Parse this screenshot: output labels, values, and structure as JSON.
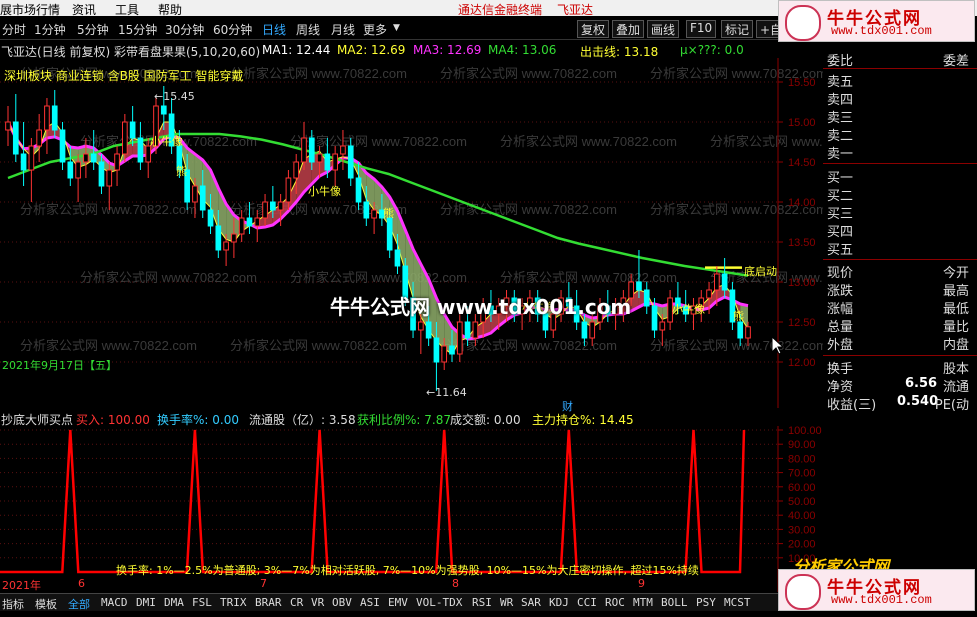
{
  "menubar": {
    "items": [
      "展市场行情",
      "资讯",
      "工具",
      "帮助"
    ],
    "center_promo": "通达信金融终端",
    "stock_name": "飞亚达"
  },
  "toolbar": {
    "periods": [
      "分时",
      "1分钟",
      "5分钟",
      "15分钟",
      "30分钟",
      "60分钟",
      "日线",
      "周线",
      "月线",
      "更多"
    ],
    "active_period": "日线",
    "more_arrow": "▼",
    "buttons": [
      "复权",
      "叠加",
      "画线",
      "F10",
      "标记",
      "+自选"
    ]
  },
  "infobar": {
    "title": "飞亚达(日线 前复权) 彩带看盘果果(5,10,20,60)",
    "ma1": "MA1: 12.44",
    "ma2": "MA2: 12.69",
    "ma3": "MA3: 12.69",
    "ma4": "MA4: 13.06",
    "chuji": "出击线: 13.18",
    "mu": "μ×???: 0.0"
  },
  "chart_info": {
    "sectors": "深圳板块 商业连锁 含B股 国防军工 智能穿戴",
    "high_mark": "15.45",
    "low_mark": "11.64",
    "date": "2021年9月17日【五】",
    "di_qi": "底启动",
    "labels": {
      "xn1": "小牛像",
      "xn2": "小牛像",
      "xn3": "小牛像",
      "xn4": "小牛像",
      "ting1": "熊",
      "ting2": "熊",
      "ting3": "熊"
    },
    "cai": "财",
    "yaxis": [
      "15.50",
      "15.00",
      "14.50",
      "14.00",
      "13.50",
      "13.00",
      "12.50",
      "12.00"
    ],
    "watermark": "分析家公式网 www.70822.com"
  },
  "overlay_watermark": "牛牛公式网 www.tdx001.com",
  "panel": {
    "header_left": "委比",
    "header_right": "委差",
    "sells": [
      "卖五",
      "卖四",
      "卖三",
      "卖二",
      "卖一"
    ],
    "buys": [
      "买一",
      "买二",
      "买三",
      "买四",
      "买五"
    ],
    "stats_left": [
      "现价",
      "涨跌",
      "涨幅",
      "总量",
      "外盘"
    ],
    "stats_right": [
      "今开",
      "最高",
      "最低",
      "量比",
      "内盘"
    ],
    "fin": [
      {
        "l": "换手",
        "r": "股本"
      },
      {
        "l": "净资",
        "v": "6.56",
        "r": "流通"
      },
      {
        "l": "收益(三)",
        "v": "0.540",
        "r": "PE(动"
      }
    ]
  },
  "indicator": {
    "name": "抄底大师买点",
    "buy": "买入: 100.00",
    "turnover": "换手率%: 0.00",
    "float": "流通股（亿）: 3.58",
    "profit": "获利比例%: 7.87",
    "amount": "成交额: 0.00",
    "main": "主力持仓%: 14.45",
    "yaxis": [
      "100.00",
      "90.00",
      "80.00",
      "70.00",
      "60.00",
      "50.00",
      "40.00",
      "30.00",
      "20.00",
      "10.00"
    ],
    "note": "换手率: 1%—2.5%为普通股; 3%—7%为相对活跃股, 7%—10%为强势股, 10%—15%为大庄密切操作, 超过15%持续"
  },
  "xaxis": {
    "year": "2021年",
    "months": [
      "6",
      "7",
      "8",
      "9"
    ]
  },
  "tabs": [
    "指标",
    "模板",
    "全部",
    "MACD",
    "DMI",
    "DMA",
    "FSL",
    "TRIX",
    "BRAR",
    "CR",
    "VR",
    "OBV",
    "ASI",
    "EMV",
    "VOL-TDX",
    "RSI",
    "WR",
    "SAR",
    "KDJ",
    "CCI",
    "ROC",
    "MTM",
    "BOLL",
    "PSY",
    "MCST"
  ],
  "ads": {
    "top": {
      "name": "牛牛公式网",
      "url": "www.tdx001.com"
    },
    "bottom": {
      "name": "牛牛公式网",
      "url": "www.tdx001.com"
    },
    "partial": "分析家公式网"
  },
  "colors": {
    "up": "#ff3333",
    "down": "#00ffff",
    "ma_yellow": "#ffff33",
    "ma_magenta": "#ff33ff",
    "ma_green": "#33dd33",
    "band": "#8fae6b",
    "band_red": "#c0404a",
    "ind": "#ff0000"
  },
  "chart_data": {
    "type": "candlestick",
    "ylim": [
      11.5,
      15.75
    ],
    "yticks": [
      15.5,
      15.0,
      14.5,
      14.0,
      13.5,
      13.0,
      12.5,
      12.0
    ],
    "ohlc": [
      [
        14.9,
        15.2,
        14.7,
        15.0
      ],
      [
        15.0,
        15.35,
        14.5,
        14.6
      ],
      [
        14.6,
        15.0,
        14.2,
        14.4
      ],
      [
        14.4,
        14.8,
        14.0,
        14.7
      ],
      [
        14.7,
        15.1,
        14.5,
        14.9
      ],
      [
        14.9,
        15.3,
        14.6,
        15.2
      ],
      [
        15.2,
        15.4,
        14.8,
        14.9
      ],
      [
        14.9,
        15.0,
        14.4,
        14.5
      ],
      [
        14.5,
        14.7,
        14.2,
        14.3
      ],
      [
        14.3,
        14.6,
        14.0,
        14.5
      ],
      [
        14.5,
        14.8,
        14.3,
        14.6
      ],
      [
        14.6,
        14.9,
        14.4,
        14.5
      ],
      [
        14.5,
        14.6,
        14.1,
        14.2
      ],
      [
        14.2,
        14.5,
        13.9,
        14.4
      ],
      [
        14.4,
        14.7,
        14.2,
        14.6
      ],
      [
        14.6,
        15.1,
        14.5,
        15.0
      ],
      [
        15.0,
        15.2,
        14.7,
        14.8
      ],
      [
        14.8,
        15.0,
        14.4,
        14.5
      ],
      [
        14.5,
        14.8,
        14.3,
        14.7
      ],
      [
        14.7,
        15.3,
        14.6,
        15.2
      ],
      [
        15.2,
        15.45,
        14.9,
        15.1
      ],
      [
        15.1,
        15.3,
        14.6,
        14.7
      ],
      [
        14.7,
        14.9,
        14.3,
        14.4
      ],
      [
        14.4,
        14.6,
        13.9,
        14.0
      ],
      [
        14.0,
        14.3,
        13.8,
        14.2
      ],
      [
        14.2,
        14.4,
        13.8,
        13.9
      ],
      [
        13.9,
        14.1,
        13.6,
        13.7
      ],
      [
        13.7,
        13.9,
        13.3,
        13.4
      ],
      [
        13.4,
        13.6,
        13.2,
        13.5
      ],
      [
        13.5,
        13.8,
        13.3,
        13.6
      ],
      [
        13.6,
        13.9,
        13.5,
        13.8
      ],
      [
        13.8,
        14.0,
        13.6,
        13.7
      ],
      [
        13.7,
        13.9,
        13.5,
        13.8
      ],
      [
        13.8,
        14.1,
        13.7,
        14.0
      ],
      [
        14.0,
        14.2,
        13.8,
        13.9
      ],
      [
        13.9,
        14.1,
        13.7,
        14.0
      ],
      [
        14.0,
        14.4,
        13.9,
        14.3
      ],
      [
        14.3,
        14.6,
        14.1,
        14.5
      ],
      [
        14.5,
        15.0,
        14.4,
        14.8
      ],
      [
        14.8,
        14.9,
        14.4,
        14.5
      ],
      [
        14.5,
        14.7,
        14.3,
        14.6
      ],
      [
        14.6,
        14.8,
        14.3,
        14.4
      ],
      [
        14.4,
        14.7,
        14.2,
        14.6
      ],
      [
        14.6,
        14.9,
        14.4,
        14.7
      ],
      [
        14.7,
        14.8,
        14.2,
        14.3
      ],
      [
        14.3,
        14.5,
        13.9,
        14.0
      ],
      [
        14.0,
        14.2,
        13.7,
        13.8
      ],
      [
        13.8,
        14.0,
        13.6,
        13.9
      ],
      [
        13.9,
        14.1,
        13.7,
        13.8
      ],
      [
        13.8,
        13.9,
        13.3,
        13.4
      ],
      [
        13.4,
        13.6,
        13.1,
        13.2
      ],
      [
        13.2,
        13.3,
        12.7,
        12.8
      ],
      [
        12.8,
        13.0,
        12.3,
        12.4
      ],
      [
        12.4,
        12.6,
        12.1,
        12.5
      ],
      [
        12.5,
        12.7,
        12.2,
        12.3
      ],
      [
        12.3,
        12.5,
        11.64,
        12.0
      ],
      [
        12.0,
        12.3,
        11.9,
        12.2
      ],
      [
        12.2,
        12.4,
        12.0,
        12.1
      ],
      [
        12.1,
        12.6,
        12.0,
        12.5
      ],
      [
        12.5,
        12.7,
        12.2,
        12.3
      ],
      [
        12.3,
        12.6,
        12.2,
        12.5
      ],
      [
        12.5,
        12.8,
        12.3,
        12.7
      ],
      [
        12.7,
        12.9,
        12.5,
        12.6
      ],
      [
        12.6,
        12.8,
        12.4,
        12.7
      ],
      [
        12.7,
        12.9,
        12.5,
        12.8
      ],
      [
        12.8,
        12.9,
        12.5,
        12.6
      ],
      [
        12.6,
        12.8,
        12.4,
        12.7
      ],
      [
        12.7,
        12.9,
        12.5,
        12.8
      ],
      [
        12.8,
        12.9,
        12.5,
        12.6
      ],
      [
        12.6,
        12.7,
        12.3,
        12.4
      ],
      [
        12.4,
        12.7,
        12.3,
        12.6
      ],
      [
        12.6,
        12.9,
        12.5,
        12.8
      ],
      [
        12.8,
        13.0,
        12.6,
        12.7
      ],
      [
        12.7,
        12.9,
        12.4,
        12.5
      ],
      [
        12.5,
        12.6,
        12.2,
        12.3
      ],
      [
        12.3,
        12.6,
        12.2,
        12.5
      ],
      [
        12.5,
        12.8,
        12.4,
        12.7
      ],
      [
        12.7,
        12.9,
        12.5,
        12.6
      ],
      [
        12.6,
        12.8,
        12.4,
        12.7
      ],
      [
        12.7,
        12.9,
        12.5,
        12.8
      ],
      [
        12.8,
        13.1,
        12.7,
        13.0
      ],
      [
        13.0,
        13.4,
        12.8,
        12.9
      ],
      [
        12.9,
        13.0,
        12.6,
        12.7
      ],
      [
        12.7,
        12.8,
        12.3,
        12.4
      ],
      [
        12.4,
        12.6,
        12.2,
        12.5
      ],
      [
        12.5,
        12.9,
        12.4,
        12.8
      ],
      [
        12.8,
        13.0,
        12.6,
        12.7
      ],
      [
        12.7,
        12.9,
        12.5,
        12.6
      ],
      [
        12.6,
        12.8,
        12.4,
        12.7
      ],
      [
        12.7,
        12.9,
        12.5,
        12.8
      ],
      [
        12.8,
        13.0,
        12.6,
        12.9
      ],
      [
        12.9,
        13.2,
        12.7,
        13.1
      ],
      [
        13.1,
        13.3,
        12.8,
        12.9
      ],
      [
        12.9,
        13.0,
        12.4,
        12.5
      ],
      [
        12.5,
        12.6,
        12.2,
        12.3
      ],
      [
        12.3,
        12.5,
        12.2,
        12.44
      ]
    ],
    "ma_green": [
      14.3,
      14.4,
      14.5,
      14.55,
      14.6,
      14.7,
      14.75,
      14.8,
      14.85,
      14.85,
      14.85,
      14.82,
      14.78,
      14.72,
      14.65,
      14.58,
      14.5,
      14.42,
      14.35,
      14.25,
      14.15,
      14.05,
      13.95,
      13.85,
      13.75,
      13.65,
      13.55,
      13.48,
      13.42,
      13.36,
      13.3,
      13.25,
      13.2,
      13.16,
      13.12,
      13.08
    ],
    "signals": [
      8,
      24,
      40,
      56,
      72,
      88
    ],
    "ind_signals": [
      8,
      24,
      40,
      56,
      72,
      88
    ]
  }
}
